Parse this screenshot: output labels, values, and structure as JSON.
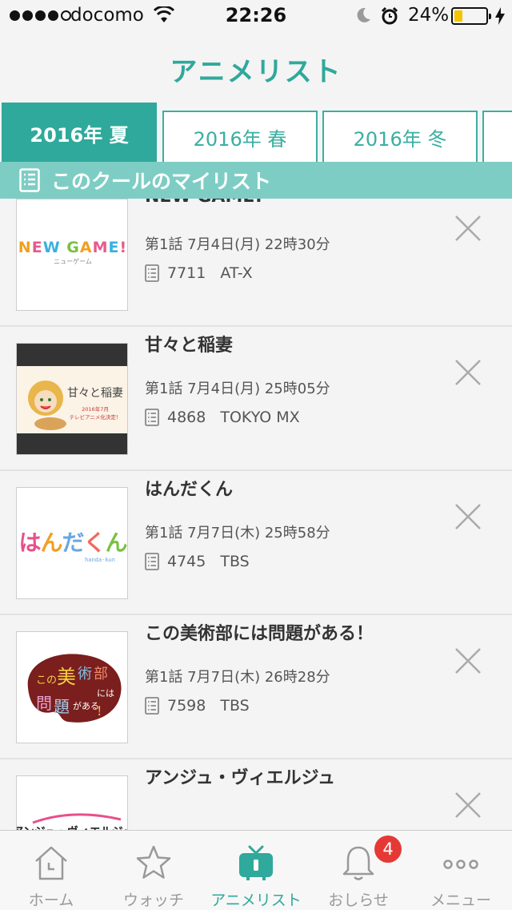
{
  "status_bar": {
    "carrier": "docomo",
    "time": "22:26",
    "battery_percent": "24%",
    "battery_level": 0.24,
    "signal_bars": 4
  },
  "header": {
    "title": "アニメリスト"
  },
  "tabs": [
    {
      "label": "2016年 夏",
      "active": true
    },
    {
      "label": "2016年 春",
      "active": false
    },
    {
      "label": "2016年 冬",
      "active": false
    }
  ],
  "mylist_bar": {
    "label": "このクールのマイリスト",
    "icon": "list-icon"
  },
  "items": [
    {
      "title": "NEW GAME!",
      "episode": "第1話 7月4日(月) 22時30分",
      "count": "7711",
      "channel": "AT-X",
      "thumb_text": "NEW GAME!",
      "thumb_sub": "ニューゲーム"
    },
    {
      "title": "甘々と稲妻",
      "episode": "第1話 7月4日(月) 25時05分",
      "count": "4868",
      "channel": "TOKYO MX",
      "thumb_text": "甘々と稲妻",
      "thumb_sub": "2016年7月 テレビアニメ化決定！"
    },
    {
      "title": "はんだくん",
      "episode": "第1話 7月7日(木) 25時58分",
      "count": "4745",
      "channel": "TBS",
      "thumb_text": "はんだくん",
      "thumb_sub": "handa-kun"
    },
    {
      "title": "この美術部には問題がある！",
      "episode": "第1話 7月7日(木) 26時28分",
      "count": "7598",
      "channel": "TBS",
      "thumb_text": "この美術部には問題がある！"
    },
    {
      "title": "アンジュ・ヴィエルジュ",
      "thumb_text": "アンジュ・ヴィエルジュ"
    }
  ],
  "tab_bar": [
    {
      "label": "ホーム",
      "icon": "home-icon"
    },
    {
      "label": "ウォッチ",
      "icon": "star-icon"
    },
    {
      "label": "アニメリスト",
      "icon": "tv-icon",
      "active": true
    },
    {
      "label": "おしらせ",
      "icon": "bell-icon",
      "badge": "4"
    },
    {
      "label": "メニュー",
      "icon": "more-icon"
    }
  ],
  "colors": {
    "accent": "#2fa99b",
    "accent_light": "#7ecdc4",
    "badge": "#e53935",
    "battery": "#f5c400"
  }
}
